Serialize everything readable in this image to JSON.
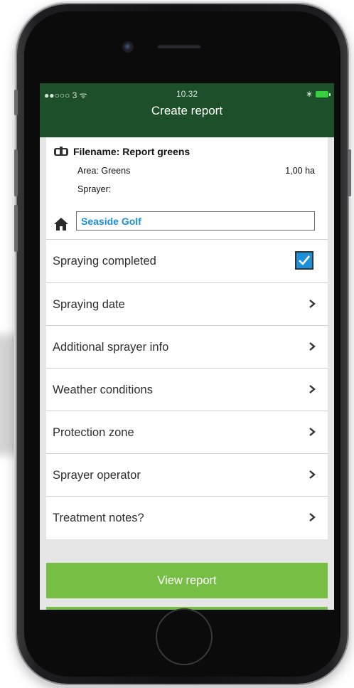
{
  "status_bar": {
    "signal": "●●○○○ 3 ᯤ",
    "time": "10.32",
    "bluetooth": "∗"
  },
  "header": {
    "title": "Create report"
  },
  "file": {
    "name": "Filename: Report greens",
    "area_label": "Area: Greens",
    "area_value": "1,00 ha",
    "sprayer_label": "Sprayer:"
  },
  "location": {
    "value": "Seaside Golf"
  },
  "rows": [
    {
      "label": "Spraying completed",
      "type": "checkbox",
      "checked": true
    },
    {
      "label": "Spraying date",
      "type": "nav"
    },
    {
      "label": "Additional sprayer info",
      "type": "nav"
    },
    {
      "label": "Weather conditions",
      "type": "nav"
    },
    {
      "label": "Protection zone",
      "type": "nav"
    },
    {
      "label": "Sprayer operator",
      "type": "nav"
    },
    {
      "label": "Treatment notes?",
      "type": "nav"
    }
  ],
  "actions": {
    "view_report": "View report"
  },
  "colors": {
    "header_bg": "#1d4f2a",
    "accent_blue": "#1b8fd8",
    "button_green": "#77be44",
    "screen_bg": "#e6e6e6"
  },
  "icons": [
    "sprayer-icon",
    "home-icon",
    "checkmark-icon",
    "chevron-right-icon",
    "battery-icon",
    "wifi-icon"
  ]
}
